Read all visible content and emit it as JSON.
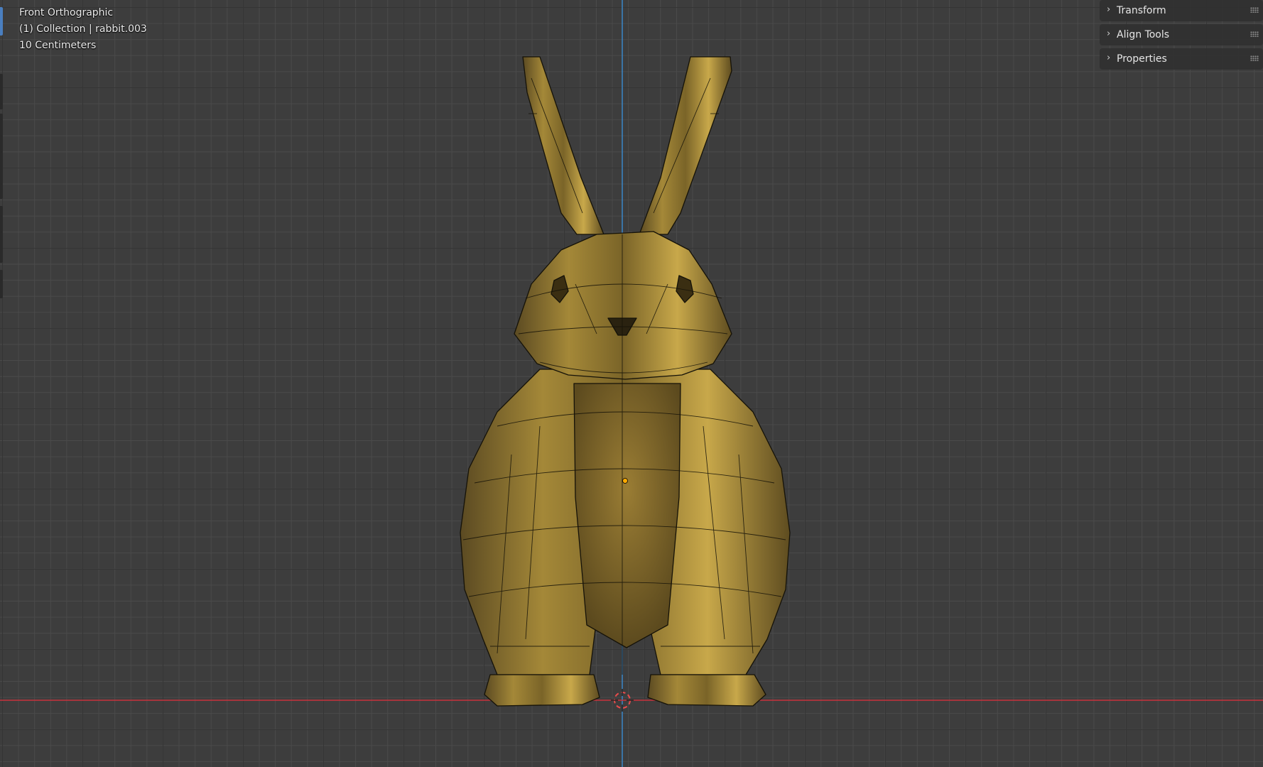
{
  "viewport": {
    "view_name": "Front Orthographic",
    "collection_info": "(1) Collection | rabbit.003",
    "scale_info": "10 Centimeters"
  },
  "n_panel": {
    "items": [
      {
        "label": "Transform",
        "icon": "chevron-right-icon"
      },
      {
        "label": "Align Tools",
        "icon": "chevron-right-icon"
      },
      {
        "label": "Properties",
        "icon": "chevron-right-icon"
      }
    ]
  },
  "colors": {
    "x_axis": "#c8323c",
    "z_axis": "#3a86c8",
    "grid": "#4a4a4a",
    "background": "#3d3d3d",
    "mesh_gold": "#a8893c",
    "origin": "#ffaa00"
  }
}
